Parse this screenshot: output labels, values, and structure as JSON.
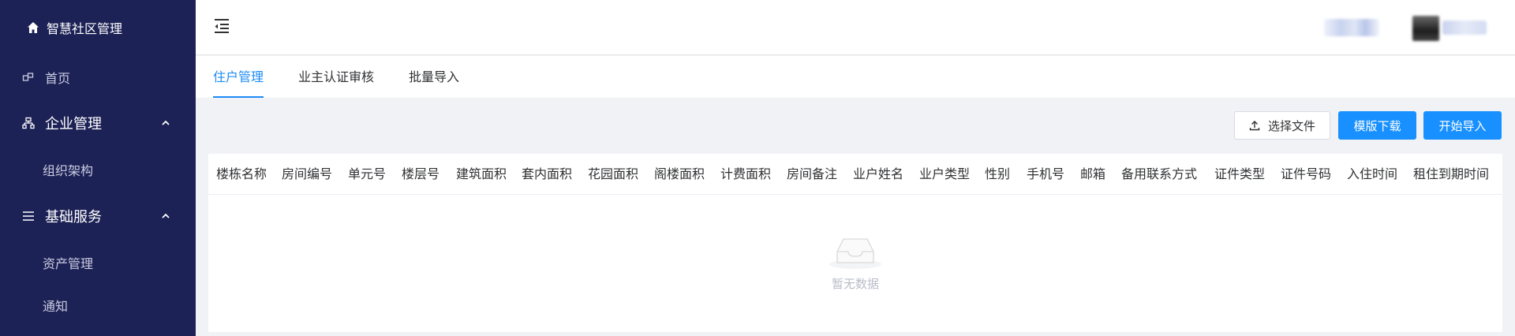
{
  "sidebar": {
    "brand": "智慧社区管理",
    "home": "首页",
    "groups": [
      {
        "label": "企业管理",
        "items": [
          "组织架构"
        ]
      },
      {
        "label": "基础服务",
        "items": [
          "资产管理",
          "通知"
        ]
      }
    ]
  },
  "tabs": [
    "住户管理",
    "业主认证审核",
    "批量导入"
  ],
  "toolbar": {
    "select_file": "选择文件",
    "template_download": "模版下载",
    "start_import": "开始导入"
  },
  "table": {
    "columns": [
      "楼栋名称",
      "房间编号",
      "单元号",
      "楼层号",
      "建筑面积",
      "套内面积",
      "花园面积",
      "阁楼面积",
      "计费面积",
      "房间备注",
      "业户姓名",
      "业户类型",
      "性别",
      "手机号",
      "邮箱",
      "备用联系方式",
      "证件类型",
      "证件号码",
      "入住时间",
      "租住到期时间"
    ],
    "empty_text": "暂无数据"
  },
  "colors": {
    "sidebar_bg": "#1d2256",
    "accent": "#1890ff"
  },
  "icons": [
    "home-icon",
    "dashboard-icon",
    "org-icon",
    "list-icon",
    "chevron-up-icon",
    "menu-fold-icon",
    "upload-icon",
    "empty-inbox-icon"
  ]
}
